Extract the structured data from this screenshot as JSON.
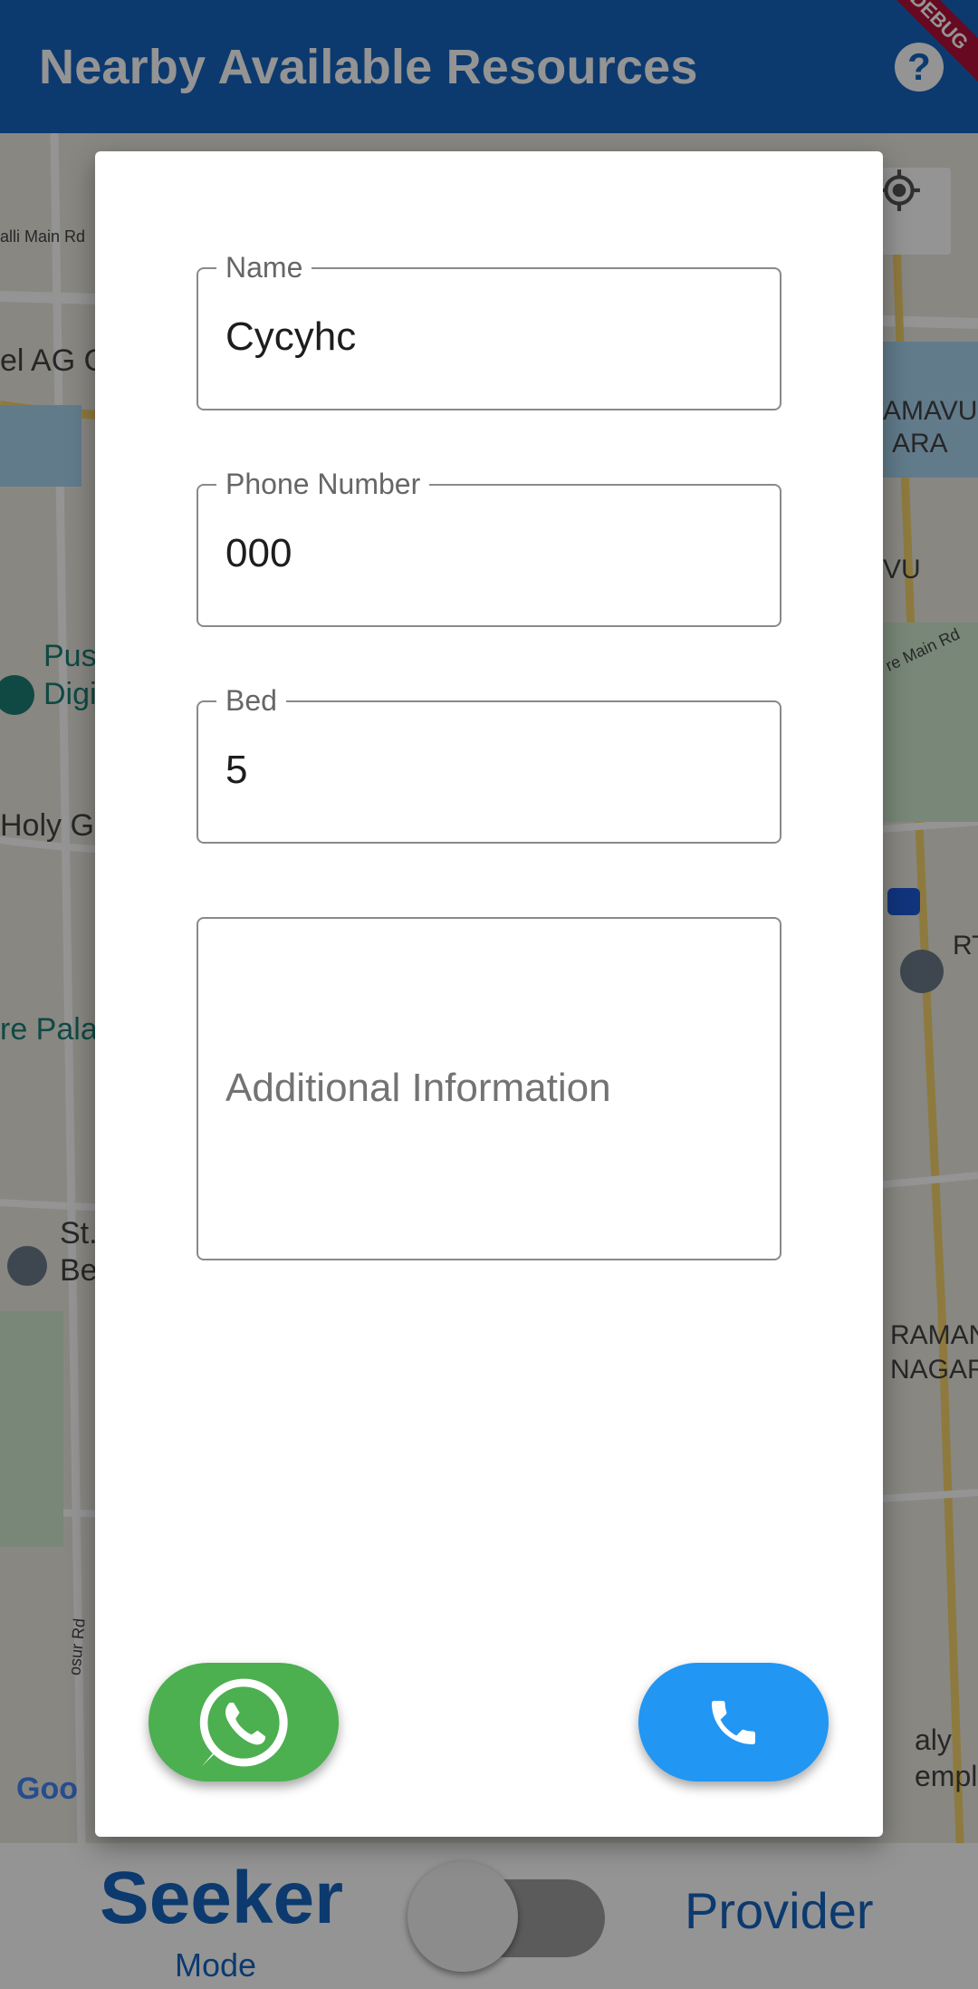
{
  "appbar": {
    "title": "Nearby Available Resources",
    "help_icon": "help-circle-icon",
    "debug_banner": "DEBUG"
  },
  "map": {
    "labels": [
      "alli Main Rd",
      "el AG O",
      "AMAVU",
      "ARA",
      "VU",
      "Pus",
      "Digi",
      "Holy Gh",
      "re Pala",
      "RT",
      "St.",
      "Be",
      "RAMAN",
      "NAGAR",
      "osur Rd",
      "re Main Rd",
      "Goo",
      "aly",
      "emple"
    ],
    "locate_icon": "my-location-icon"
  },
  "dialog": {
    "name_field": {
      "label": "Name",
      "value": "Cycyhc"
    },
    "phone_field": {
      "label": "Phone Number",
      "value": "000"
    },
    "bed_field": {
      "label": "Bed",
      "value": "5"
    },
    "info_field": {
      "placeholder": "Additional Information",
      "value": ""
    },
    "whatsapp_icon": "whatsapp-icon",
    "call_icon": "phone-icon"
  },
  "modebar": {
    "seeker_label": "Seeker",
    "mode_label": "Mode",
    "provider_label": "Provider",
    "switch_on": false
  },
  "colors": {
    "primary": "#1565c0",
    "whatsapp": "#4caf50",
    "call": "#2196f3"
  }
}
